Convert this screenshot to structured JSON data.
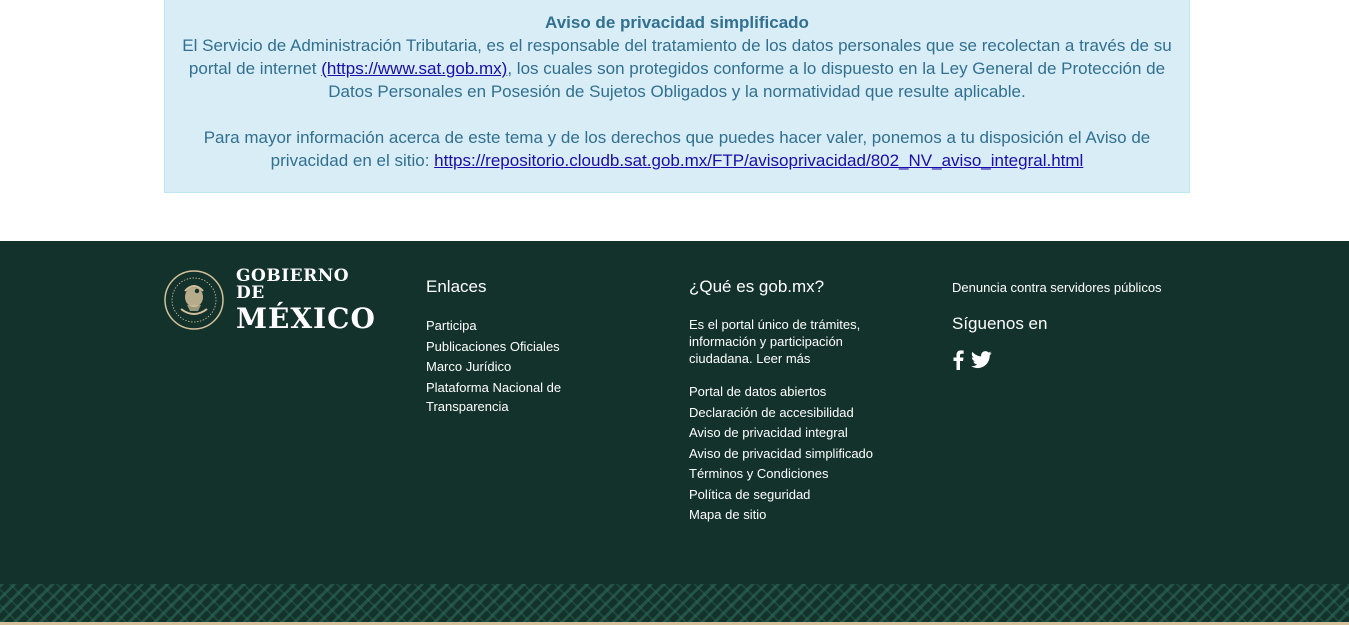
{
  "privacy_notice": {
    "title": "Aviso de privacidad simplificado",
    "para1_before": "El Servicio de Administración Tributaria, es el responsable del tratamiento de los datos personales que se recolectan a través de su portal de internet ",
    "para1_link": "(https://www.sat.gob.mx)",
    "para1_after": ", los cuales son protegidos conforme a lo dispuesto en la Ley General de Protección de Datos Personales en Posesión de Sujetos Obligados y la normatividad que resulte aplicable.",
    "para2_before": "Para mayor información acerca de este tema y de los derechos que puedes hacer valer, ponemos a tu disposición el Aviso de privacidad en el sitio: ",
    "para2_link": "https://repositorio.cloudb.sat.gob.mx/FTP/avisoprivacidad/802_NV_aviso_integral.html"
  },
  "footer": {
    "logo": {
      "line1": "GOBIERNO DE",
      "line2": "MÉXICO"
    },
    "enlaces": {
      "heading": "Enlaces",
      "items": [
        "Participa",
        "Publicaciones Oficiales",
        "Marco Jurídico",
        "Plataforma Nacional de Transparencia"
      ]
    },
    "que_es": {
      "heading": "¿Qué es gob.mx?",
      "description": "Es el portal único de trámites, información y participación ciudadana. Leer más",
      "items": [
        "Portal de datos abiertos",
        "Declaración de accesibilidad",
        "Aviso de privacidad integral",
        "Aviso de privacidad simplificado",
        "Términos y Condiciones",
        "Política de seguridad",
        "Mapa de sitio"
      ]
    },
    "denuncia": "Denuncia contra servidores públicos",
    "siguenos": "Síguenos en",
    "social_icons": [
      "facebook-icon",
      "twitter-icon"
    ]
  },
  "colors": {
    "notice_bg": "#d9edf7",
    "notice_text": "#31708f",
    "footer_bg": "#13322b",
    "gold": "#d4c19c"
  }
}
